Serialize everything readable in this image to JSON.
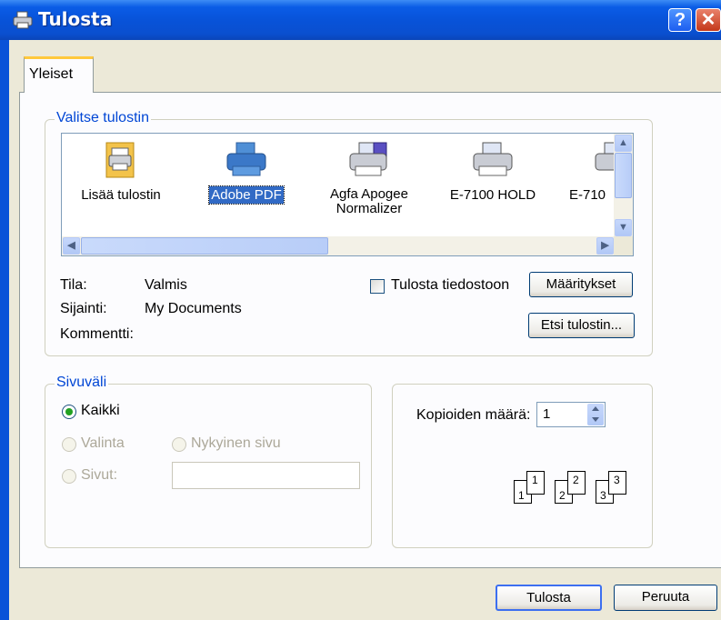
{
  "window": {
    "title": "Tulosta",
    "help_label": "?",
    "close_label": "✕"
  },
  "tabs": [
    {
      "label": "Yleiset"
    }
  ],
  "select_printer": {
    "group_label": "Valitse tulostin",
    "printers": [
      {
        "label": "Lisää tulostin",
        "icon": "add-printer-icon"
      },
      {
        "label": "Adobe PDF",
        "icon": "printer-icon",
        "selected": true
      },
      {
        "label": "Agfa Apogee\nNormalizer",
        "icon": "printer-icon"
      },
      {
        "label": "E-7100 HOLD",
        "icon": "printer-icon"
      },
      {
        "label": "E-710",
        "icon": "printer-icon"
      }
    ],
    "status_label": "Tila:",
    "status_value": "Valmis",
    "location_label": "Sijainti:",
    "location_value": "My Documents",
    "comment_label": "Kommentti:",
    "print_to_file_label": "Tulosta tiedostoon",
    "print_to_file_checked": false,
    "preferences_button": "Määritykset",
    "find_printer_button": "Etsi tulostin..."
  },
  "page_range": {
    "group_label": "Sivuväli",
    "all_label": "Kaikki",
    "selection_label": "Valinta",
    "current_page_label": "Nykyinen sivu",
    "pages_label": "Sivut:",
    "pages_value": "",
    "selected_option": "Kaikki"
  },
  "copies": {
    "label": "Kopioiden määrä:",
    "value": "1",
    "collate_pages": [
      "1",
      "1",
      "2",
      "2",
      "3",
      "3"
    ]
  },
  "footer": {
    "print_button": "Tulosta",
    "cancel_button": "Peruuta"
  },
  "colors": {
    "titlebar": "#0a52d8",
    "dialog_bg": "#ece9d8",
    "group_label": "#0046d5",
    "selection": "#316ac5"
  }
}
